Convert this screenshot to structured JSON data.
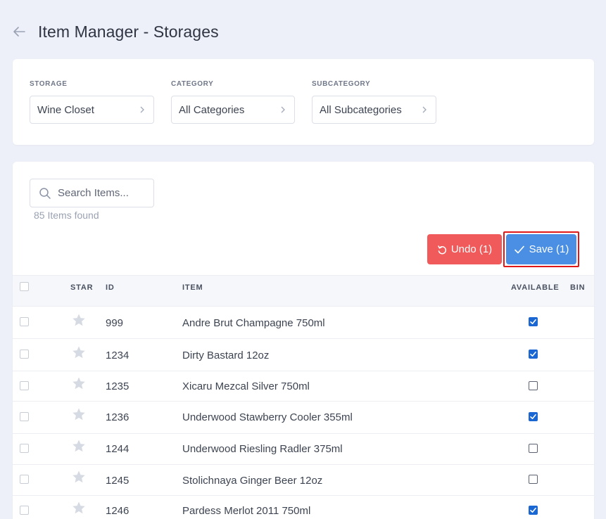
{
  "header": {
    "title": "Item Manager - Storages"
  },
  "filters": [
    {
      "label": "STORAGE",
      "value": "Wine Closet"
    },
    {
      "label": "CATEGORY",
      "value": "All Categories"
    },
    {
      "label": "SUBCATEGORY",
      "value": "All Subcategories"
    }
  ],
  "search": {
    "placeholder": "Search Items...",
    "value": ""
  },
  "items_found": "85 Items found",
  "buttons": {
    "undo_label": "Undo (1)",
    "save_label": "Save (1)"
  },
  "table": {
    "columns": [
      "STAR",
      "ID",
      "ITEM",
      "AVAILABLE",
      "BIN"
    ],
    "rows": [
      {
        "id": "999",
        "item": "Andre Brut Champagne 750ml",
        "available": true
      },
      {
        "id": "1234",
        "item": "Dirty Bastard 12oz",
        "available": true
      },
      {
        "id": "1235",
        "item": "Xicaru Mezcal Silver 750ml",
        "available": false
      },
      {
        "id": "1236",
        "item": "Underwood Stawberry Cooler 355ml",
        "available": true
      },
      {
        "id": "1244",
        "item": "Underwood Riesling Radler 375ml",
        "available": false
      },
      {
        "id": "1245",
        "item": "Stolichnaya Ginger Beer 12oz",
        "available": false
      },
      {
        "id": "1246",
        "item": "Pardess Merlot 2011 750ml",
        "available": true
      }
    ]
  },
  "colors": {
    "undo": "#f05a5a",
    "save": "#4a8fe3",
    "highlight": "#e01818",
    "checkbox_checked": "#1a66d2"
  },
  "icons": {
    "back": "arrow-left-icon",
    "search": "search-icon",
    "chevron": "chevron-right-icon",
    "star": "star-icon",
    "undo": "undo-icon",
    "save": "check-icon"
  }
}
